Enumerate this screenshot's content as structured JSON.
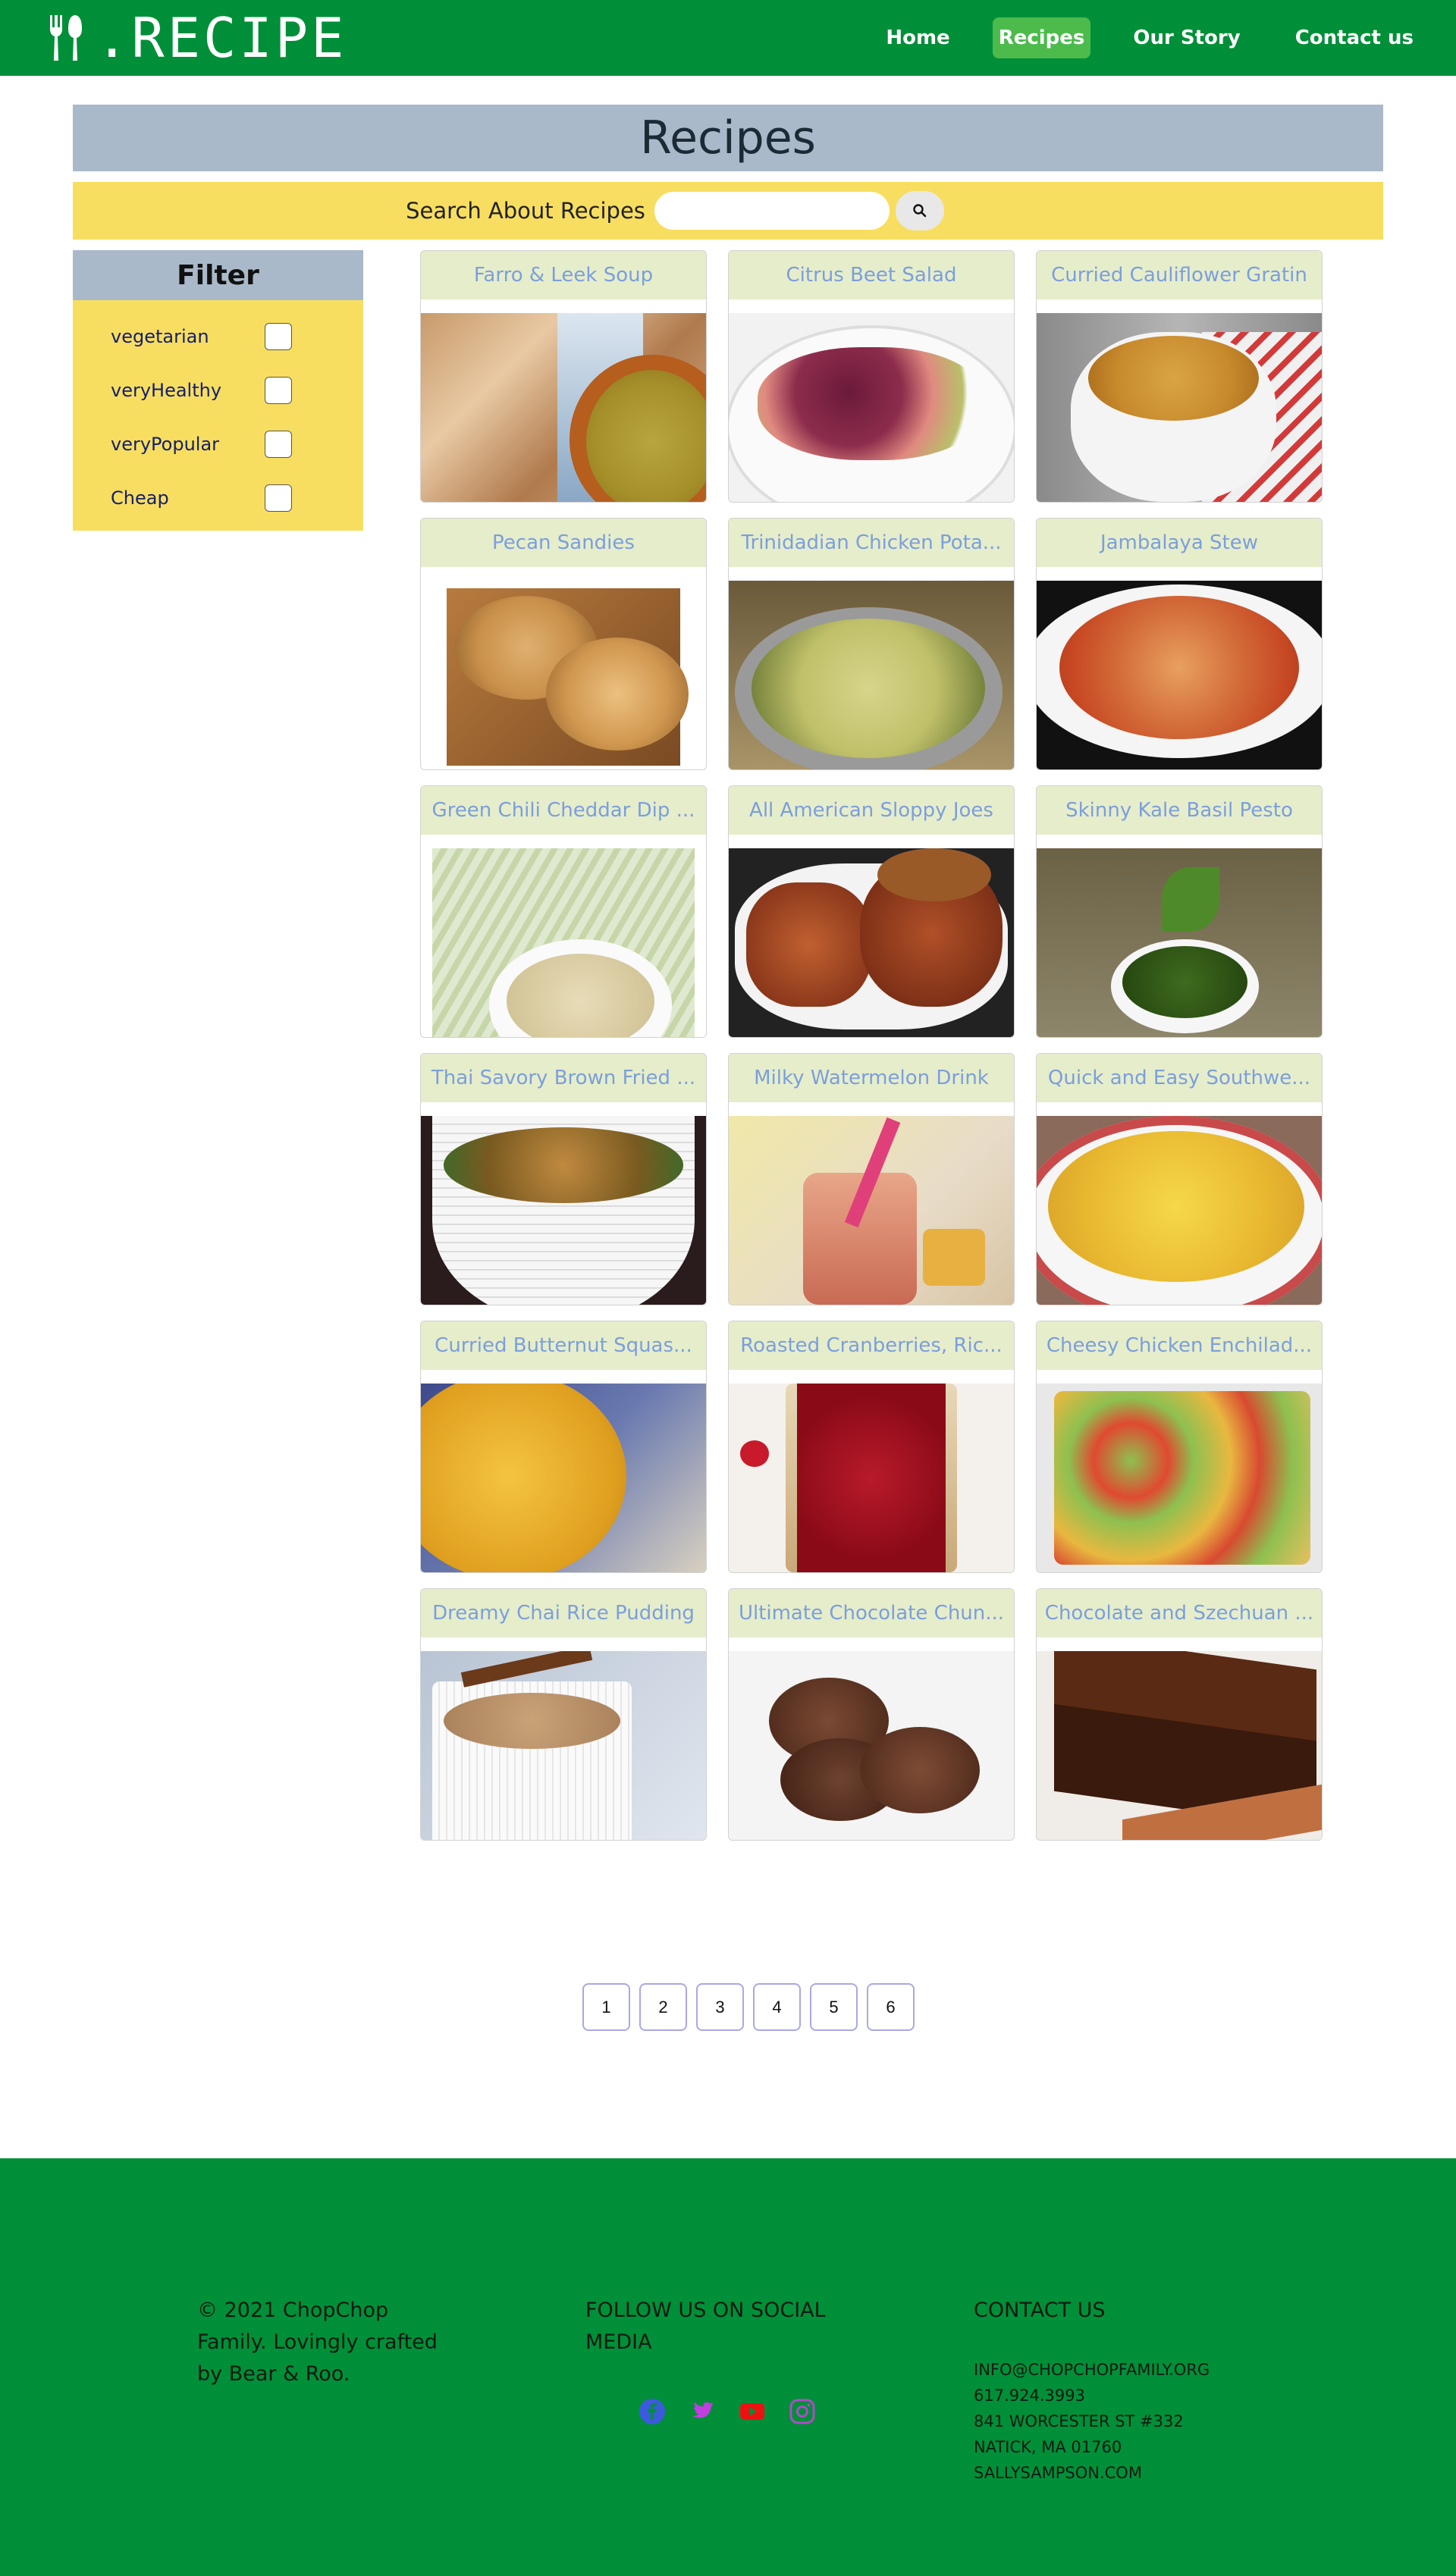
{
  "header": {
    "brand": ".RECIPE",
    "nav": [
      {
        "label": "Home",
        "active": false
      },
      {
        "label": "Recipes",
        "active": true
      },
      {
        "label": "Our Story",
        "active": false
      },
      {
        "label": "Contact us",
        "active": false
      }
    ]
  },
  "page": {
    "title": "Recipes",
    "search_label": "Search About Recipes",
    "search_value": ""
  },
  "filter": {
    "title": "Filter",
    "options": [
      {
        "label": "vegetarian",
        "checked": false
      },
      {
        "label": "veryHealthy",
        "checked": false
      },
      {
        "label": "veryPopular",
        "checked": false
      },
      {
        "label": "Cheap",
        "checked": false
      }
    ]
  },
  "recipes": [
    {
      "title": "Farro & Leek Soup"
    },
    {
      "title": "Citrus Beet Salad"
    },
    {
      "title": "Curried Cauliflower Gratin"
    },
    {
      "title": "Pecan Sandies"
    },
    {
      "title": "Trinidadian Chicken Pota..."
    },
    {
      "title": "Jambalaya Stew"
    },
    {
      "title": "Green Chili Cheddar Dip ..."
    },
    {
      "title": "All American Sloppy Joes"
    },
    {
      "title": "Skinny Kale Basil Pesto"
    },
    {
      "title": "Thai Savory Brown Fried ..."
    },
    {
      "title": "Milky Watermelon Drink"
    },
    {
      "title": "Quick and Easy Southwe..."
    },
    {
      "title": "Curried Butternut Squas..."
    },
    {
      "title": "Roasted Cranberries, Ric..."
    },
    {
      "title": "Cheesy Chicken Enchilad..."
    },
    {
      "title": "Dreamy Chai Rice Pudding"
    },
    {
      "title": "Ultimate Chocolate Chun..."
    },
    {
      "title": "Chocolate and Szechuan ..."
    }
  ],
  "pagination": {
    "pages": [
      "1",
      "2",
      "3",
      "4",
      "5",
      "6"
    ]
  },
  "footer": {
    "copyright": "© 2021 ChopChop Family. Lovingly crafted by Bear & Roo.",
    "follow_heading": "FOLLOW US ON SOCIAL MEDIA",
    "social": [
      {
        "name": "facebook-icon",
        "color": "#3b5bdb"
      },
      {
        "name": "twitter-icon",
        "color": "#c23ee0"
      },
      {
        "name": "youtube-icon",
        "color": "#ee1111"
      },
      {
        "name": "instagram-icon",
        "color": "#b04ac8"
      }
    ],
    "contact_heading": "CONTACT US",
    "contact_lines": [
      "INFO@CHOPCHOPFAMILY.ORG",
      "617.924.3993",
      "841 WORCESTER ST #332",
      "NATICK, MA 01760",
      "SALLYSAMPSON.COM"
    ]
  },
  "colors": {
    "header_green": "#008f39",
    "active_nav": "#4cbb4c",
    "title_band": "#a9b9c9",
    "yellow": "#f8de60",
    "card_title_bg": "#e6edcb",
    "card_title_text": "#7b9fdb"
  }
}
